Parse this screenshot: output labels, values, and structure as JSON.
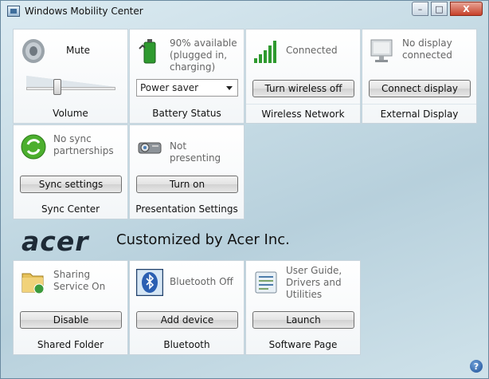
{
  "window": {
    "title": "Windows Mobility Center"
  },
  "titlebar": {
    "minimize": "–",
    "maximize": "□",
    "close": "X"
  },
  "tiles": {
    "volume": {
      "status": "Mute",
      "footer": "Volume",
      "level_percent": 30
    },
    "battery": {
      "status": "90% available (plugged in, charging)",
      "select_value": "Power saver",
      "footer": "Battery Status"
    },
    "wireless": {
      "status": "Connected",
      "button": "Turn wireless off",
      "footer": "Wireless Network"
    },
    "display": {
      "status": "No display connected",
      "button": "Connect display",
      "footer": "External Display"
    },
    "sync": {
      "status": "No sync partnerships",
      "button": "Sync settings",
      "footer": "Sync Center"
    },
    "presentation": {
      "status": "Not presenting",
      "button": "Turn on",
      "footer": "Presentation Settings"
    },
    "shared": {
      "status": "Sharing Service On",
      "button": "Disable",
      "footer": "Shared Folder"
    },
    "bluetooth": {
      "status": "Bluetooth Off",
      "button": "Add device",
      "footer": "Bluetooth"
    },
    "software": {
      "status": "User Guide, Drivers and Utilities",
      "button": "Launch",
      "footer": "Software Page"
    }
  },
  "brand": {
    "logo": "acer",
    "text": "Customized by Acer Inc."
  },
  "help": {
    "label": "?"
  },
  "icons": {
    "volume": "speaker-icon",
    "battery": "battery-icon",
    "wireless": "signal-bars-icon",
    "display": "monitor-icon",
    "sync": "sync-icon",
    "presentation": "projector-icon",
    "shared": "shared-folder-icon",
    "bluetooth": "bluetooth-icon",
    "software": "document-icon"
  }
}
